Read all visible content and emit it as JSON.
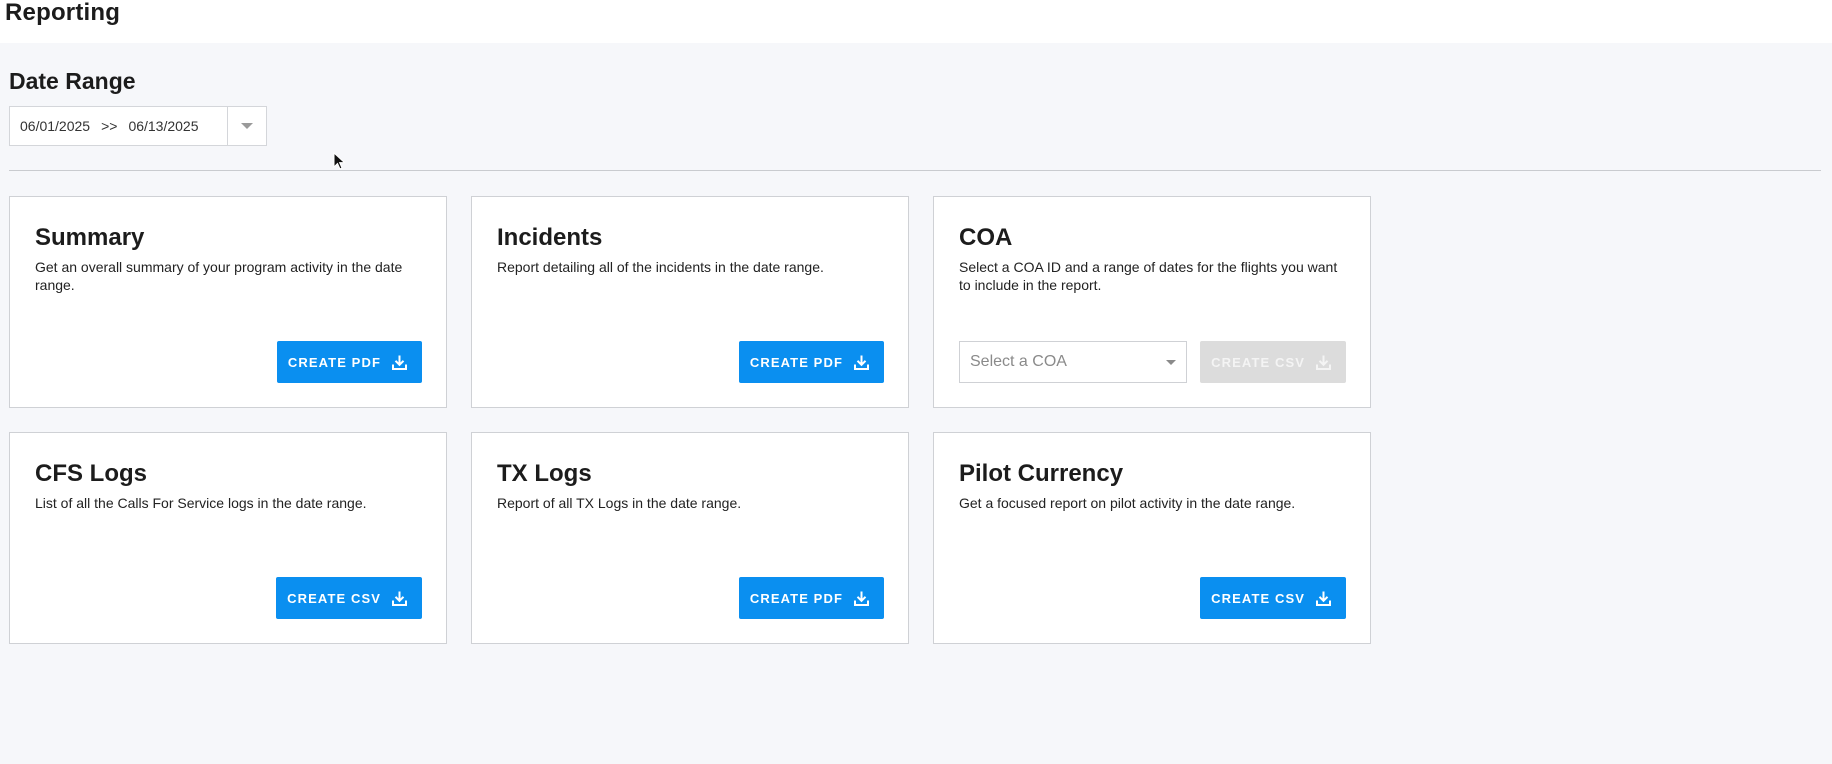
{
  "header": {
    "title": "Reporting"
  },
  "date_range": {
    "label": "Date Range",
    "start": "06/01/2025",
    "separator": ">>",
    "end": "06/13/2025"
  },
  "colors": {
    "accent": "#0a8ff0",
    "disabled": "#dcdcdc"
  },
  "cards": [
    {
      "title": "Summary",
      "description": "Get an overall summary of your program activity in the date range.",
      "button": "CREATE PDF"
    },
    {
      "title": "Incidents",
      "description": "Report detailing all of the incidents in the date range.",
      "button": "CREATE PDF"
    },
    {
      "title": "COA",
      "description": "Select a COA ID and a range of dates for the flights you want to include in the report.",
      "button": "CREATE CSV",
      "select_placeholder": "Select a COA"
    },
    {
      "title": "CFS Logs",
      "description": "List of all the Calls For Service logs in the date range.",
      "button": "CREATE CSV"
    },
    {
      "title": "TX Logs",
      "description": "Report of all TX Logs in the date range.",
      "button": "CREATE PDF"
    },
    {
      "title": "Pilot Currency",
      "description": "Get a focused report on pilot activity in the date range.",
      "button": "CREATE CSV"
    }
  ],
  "icons": {
    "download": "download-icon",
    "dropdown": "chevron-down-icon",
    "cursor": "cursor-icon"
  }
}
